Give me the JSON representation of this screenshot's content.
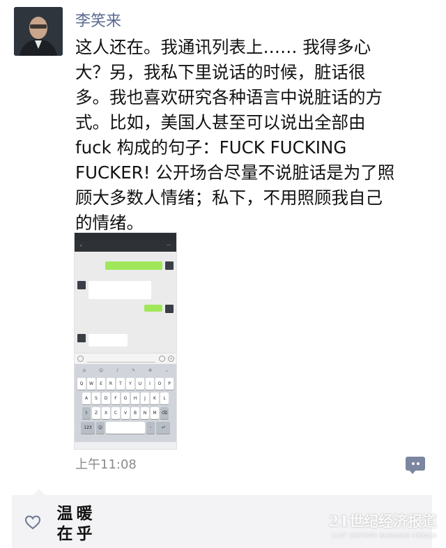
{
  "post": {
    "author": "李笑来",
    "content": "这人还在。我通讯列表上…… 我得多心\n大？另，我私下里说话的时候，脏话很\n多。我也喜欢研究各种语言中说脏话的方\n式。比如，美国人甚至可以说出全部由\nfuck 构成的句子：FUCK FUCKING\nFUCKER! 公开场合尽量不说脏话是为了照\n顾大多数人情绪；私下，不用照顾我自己\n的情绪。",
    "time": "上午11:08"
  },
  "screenshot": {
    "keyboard_rows": [
      [
        "Q",
        "W",
        "E",
        "R",
        "T",
        "Y",
        "U",
        "I",
        "O",
        "P"
      ],
      [
        "A",
        "S",
        "D",
        "F",
        "G",
        "H",
        "J",
        "K",
        "L"
      ],
      [
        "Z",
        "X",
        "C",
        "V",
        "B",
        "N",
        "M"
      ]
    ],
    "key_123": "123"
  },
  "likes": {
    "seal_chars": [
      "温",
      "暖",
      "在",
      "乎"
    ]
  },
  "watermark": {
    "title": "21世纪经济报道",
    "subtitle": "21ST CENTURY BUSINESS HERALD"
  },
  "colors": {
    "author_name": "#5b6a91",
    "comment_icon": "#7b86a0",
    "bubble_sent": "#a0e75a"
  }
}
